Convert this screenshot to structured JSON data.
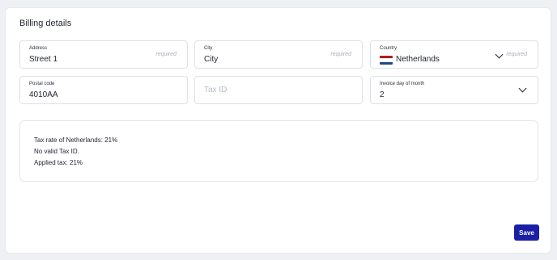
{
  "section": {
    "title": "Billing details"
  },
  "address": {
    "label": "Address",
    "value": "Street 1",
    "required": "required"
  },
  "city": {
    "label": "City",
    "value": "City",
    "required": "required"
  },
  "country": {
    "label": "Country",
    "value": "Netherlands",
    "required": "required",
    "flag_icon": "netherlands-flag-icon"
  },
  "postal_code": {
    "label": "Postal code",
    "value": "4010AA"
  },
  "tax_id": {
    "placeholder": "Tax ID"
  },
  "invoice_day": {
    "label": "Invoice day of month",
    "value": "2"
  },
  "tax_info": {
    "line1": "Tax rate of Netherlands: 21%",
    "line2": "No valid Tax ID.",
    "line3": "Applied tax: 21%"
  },
  "actions": {
    "save_label": "Save"
  },
  "colors": {
    "accent": "#1a1fa6",
    "background": "#eef0f3"
  }
}
